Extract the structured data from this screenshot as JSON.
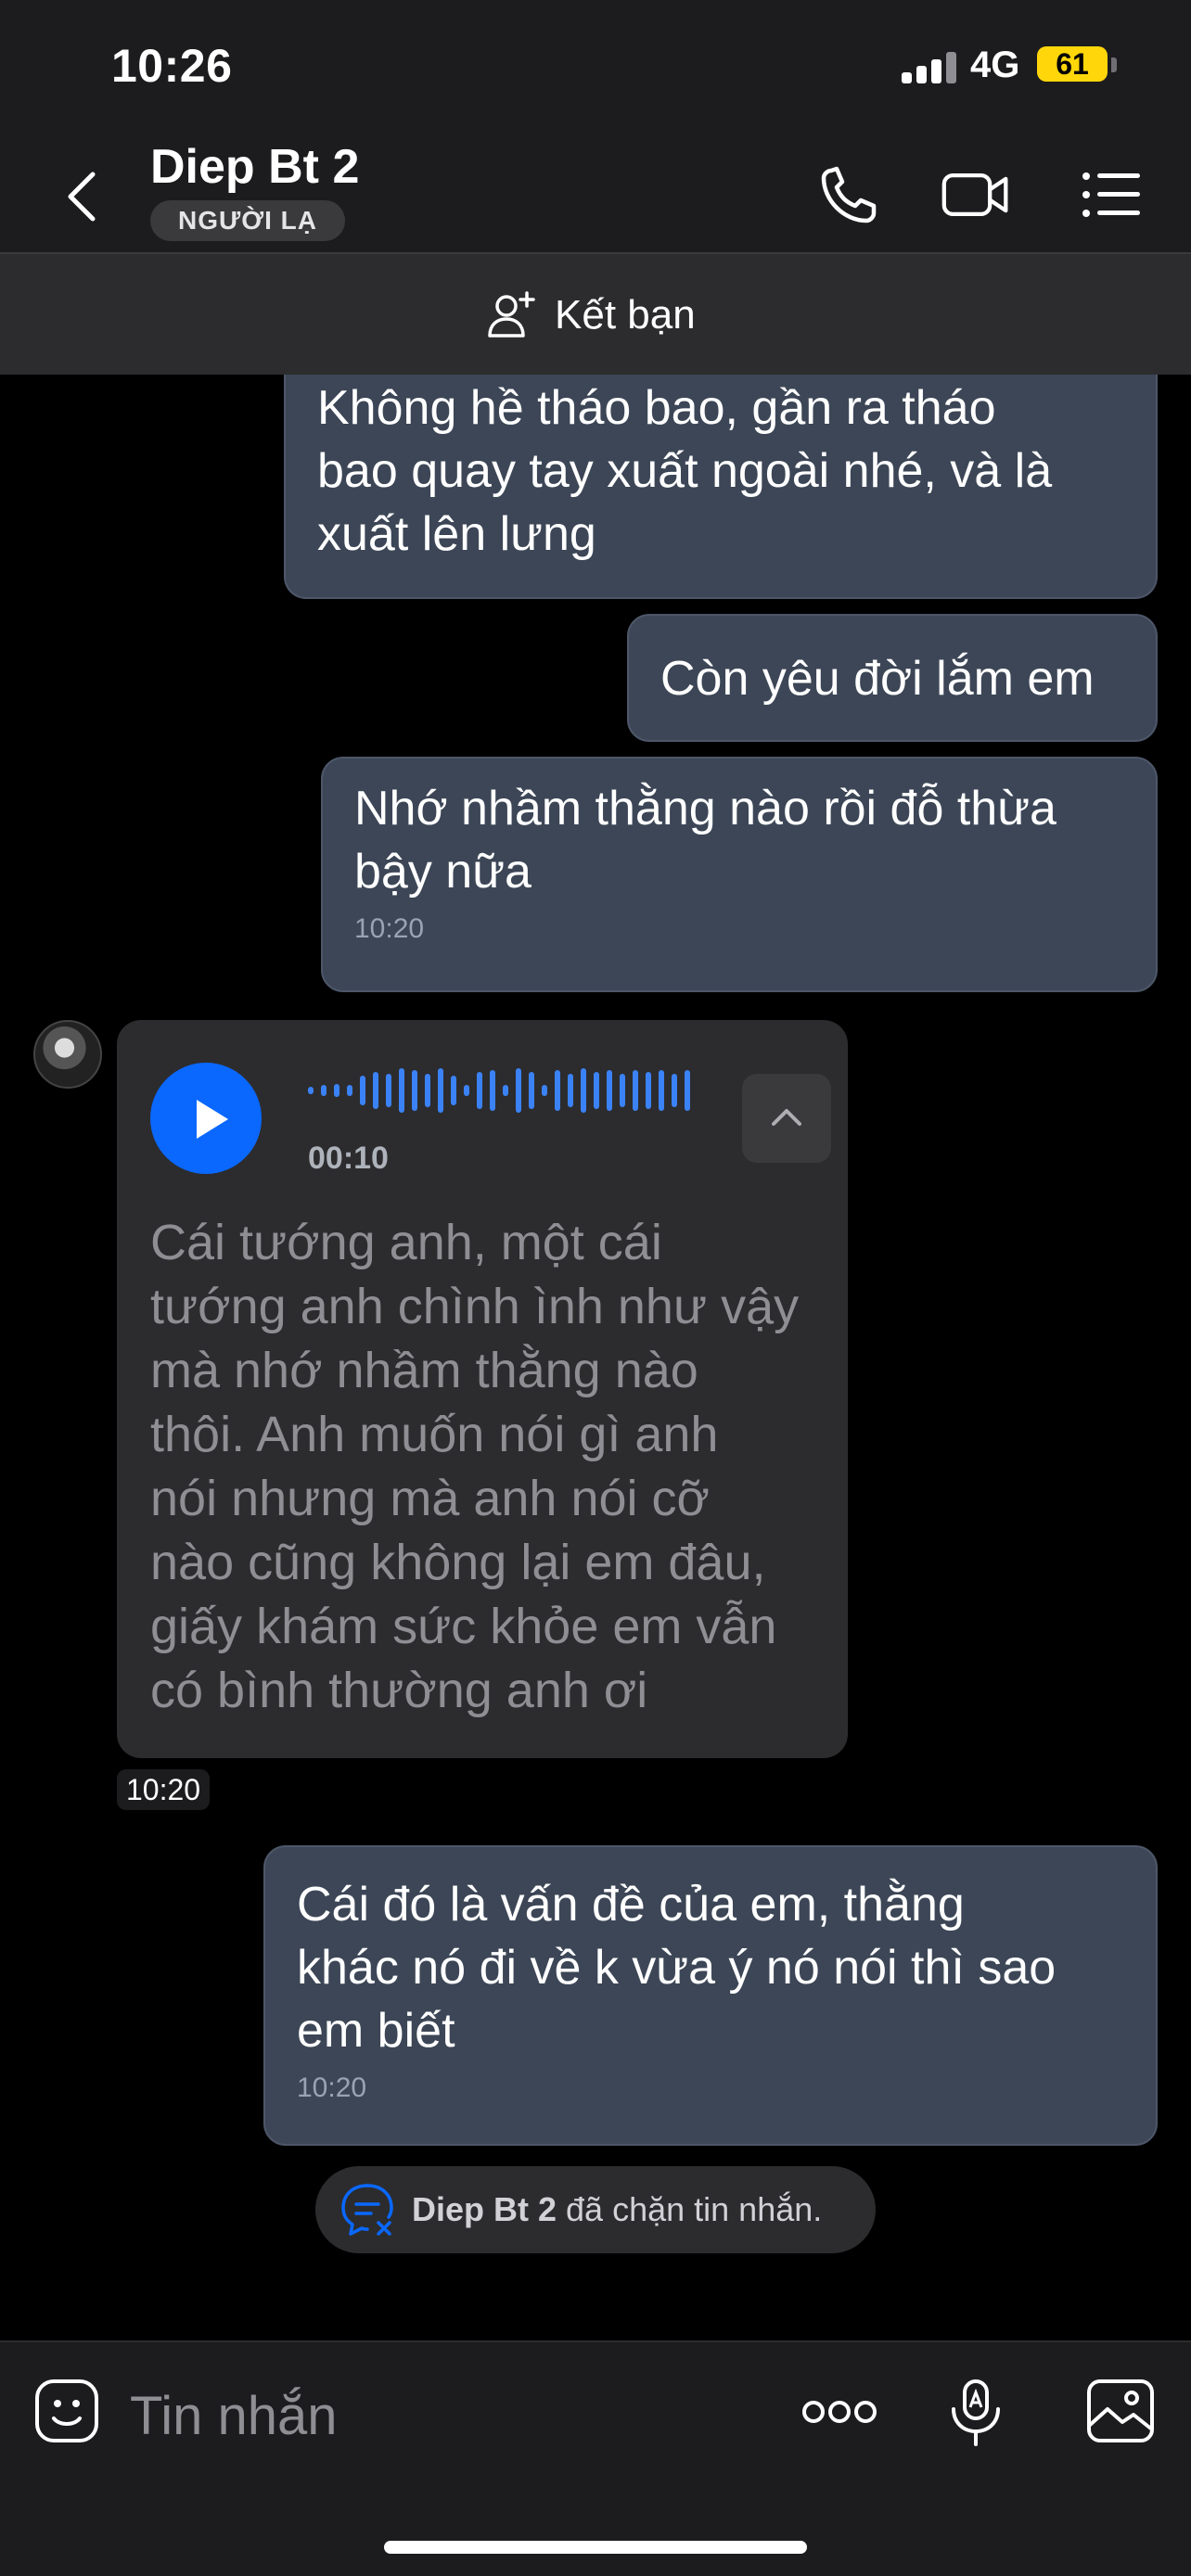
{
  "status_bar": {
    "time": "10:26",
    "network": "4G",
    "battery": "61"
  },
  "header": {
    "title": "Diep Bt 2",
    "badge": "NGƯỜI LẠ"
  },
  "friend_bar": {
    "label": "Kết bạn"
  },
  "messages": [
    {
      "side": "out",
      "lines": [
        "Không hề tháo bao, gần ra tháo",
        "bao quay tay xuất ngoài nhé, và là",
        "xuất lên lưng"
      ],
      "time": ""
    },
    {
      "side": "out",
      "lines": [
        "Còn yêu đời lắm em"
      ],
      "time": ""
    },
    {
      "side": "out",
      "lines": [
        "Nhớ nhầm thằng nào rồi đỗ thừa",
        "bậy nữa"
      ],
      "time": "10:20"
    },
    {
      "side": "in",
      "type": "voice",
      "duration": "00:10",
      "transcript_lines": [
        "Cái tướng anh, một cái",
        "tướng anh chình ình như vậy",
        "mà nhớ nhầm thằng nào",
        "thôi. Anh muốn nói gì anh",
        "nói nhưng mà anh nói cỡ",
        "nào cũng không lại em đâu,",
        "giấy khám sức khỏe em vẫn",
        "có bình thường anh ơi"
      ],
      "time": "10:20"
    },
    {
      "side": "out",
      "lines": [
        "Cái đó là vấn đề của em, thằng",
        "khác nó đi về k vừa ý nó nói thì sao",
        "em biết"
      ],
      "time": "10:20"
    }
  ],
  "blocked_notice": {
    "name": "Diep Bt 2",
    "text": "đã chặn tin nhắn."
  },
  "input": {
    "placeholder": "Tin nhắn"
  },
  "icons": {
    "back": "chevron-left-icon",
    "call": "phone-icon",
    "video": "video-icon",
    "menu": "list-menu-icon",
    "add_friend": "add-user-icon",
    "play": "play-icon",
    "collapse": "chevron-up-icon",
    "blocked": "chat-blocked-icon",
    "sticker": "sticker-icon",
    "more": "more-icon",
    "voice_input": "microphone-icon",
    "gallery": "image-icon"
  },
  "colors": {
    "accent": "#0a68ff",
    "outgoing_bubble": "#3c4656",
    "incoming_bubble": "#2c2c2e",
    "battery": "#ffd60a"
  }
}
